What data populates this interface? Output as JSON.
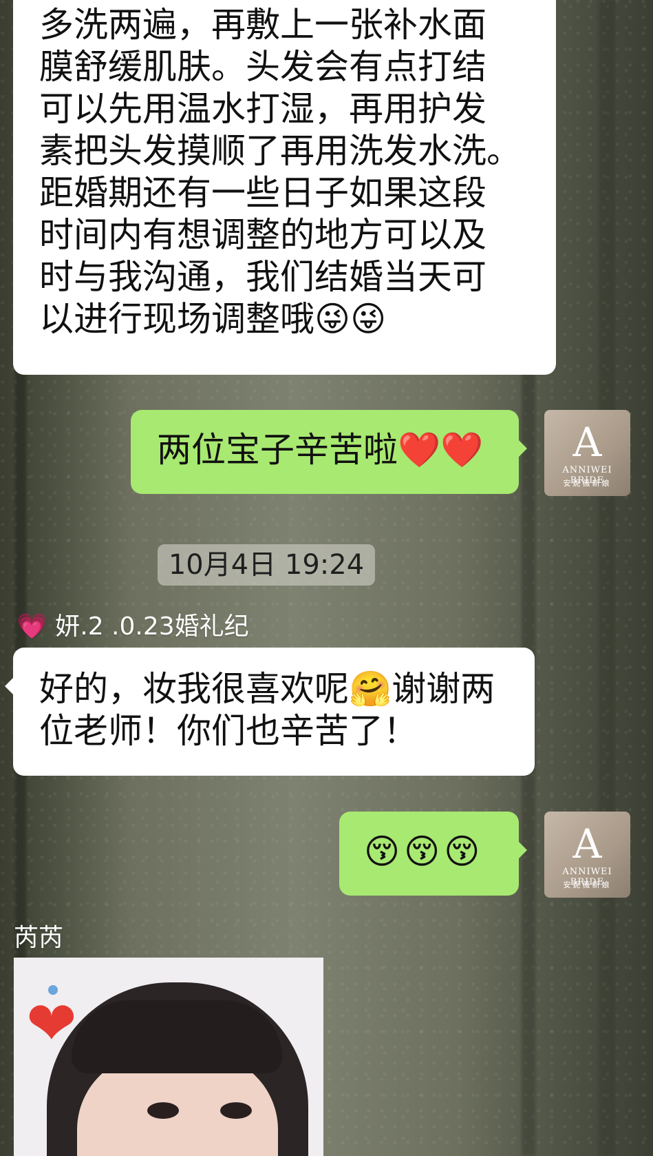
{
  "messages": [
    {
      "sender": "",
      "text_lines": [
        "多洗两遍，再敷上一张补水面",
        "膜舒缓肌肤。头发会有点打结",
        "可以先用温水打湿，再用护发",
        "素把头发摸顺了再用洗发水洗。",
        "距婚期还有一些日子如果这段",
        "时间内有想调整的地方可以及",
        "时与我沟通，我们结婚当天可",
        "以进行现场调整哦😜😜"
      ]
    },
    {
      "sender": "me",
      "text": "两位宝子辛苦啦❤️❤️"
    },
    {
      "timestamp": "10月4日 19:24"
    },
    {
      "sender": "💗 妍.2   .0.23婚礼纪",
      "text_lines": [
        "好的，妆我很喜欢呢🤗谢谢两",
        "位老师！你们也辛苦了！"
      ]
    },
    {
      "sender": "me",
      "text": "😚😚😚"
    },
    {
      "sender": "芮芮",
      "image_caption": "photo message"
    }
  ],
  "avatar": {
    "logo": "A",
    "brand_en": "ANNIWEI BRIDE",
    "brand_cn": "安妮薇新娘"
  },
  "colors": {
    "left_bubble": "#ffffff",
    "right_bubble": "#a8e971",
    "background": "#6d705e"
  }
}
